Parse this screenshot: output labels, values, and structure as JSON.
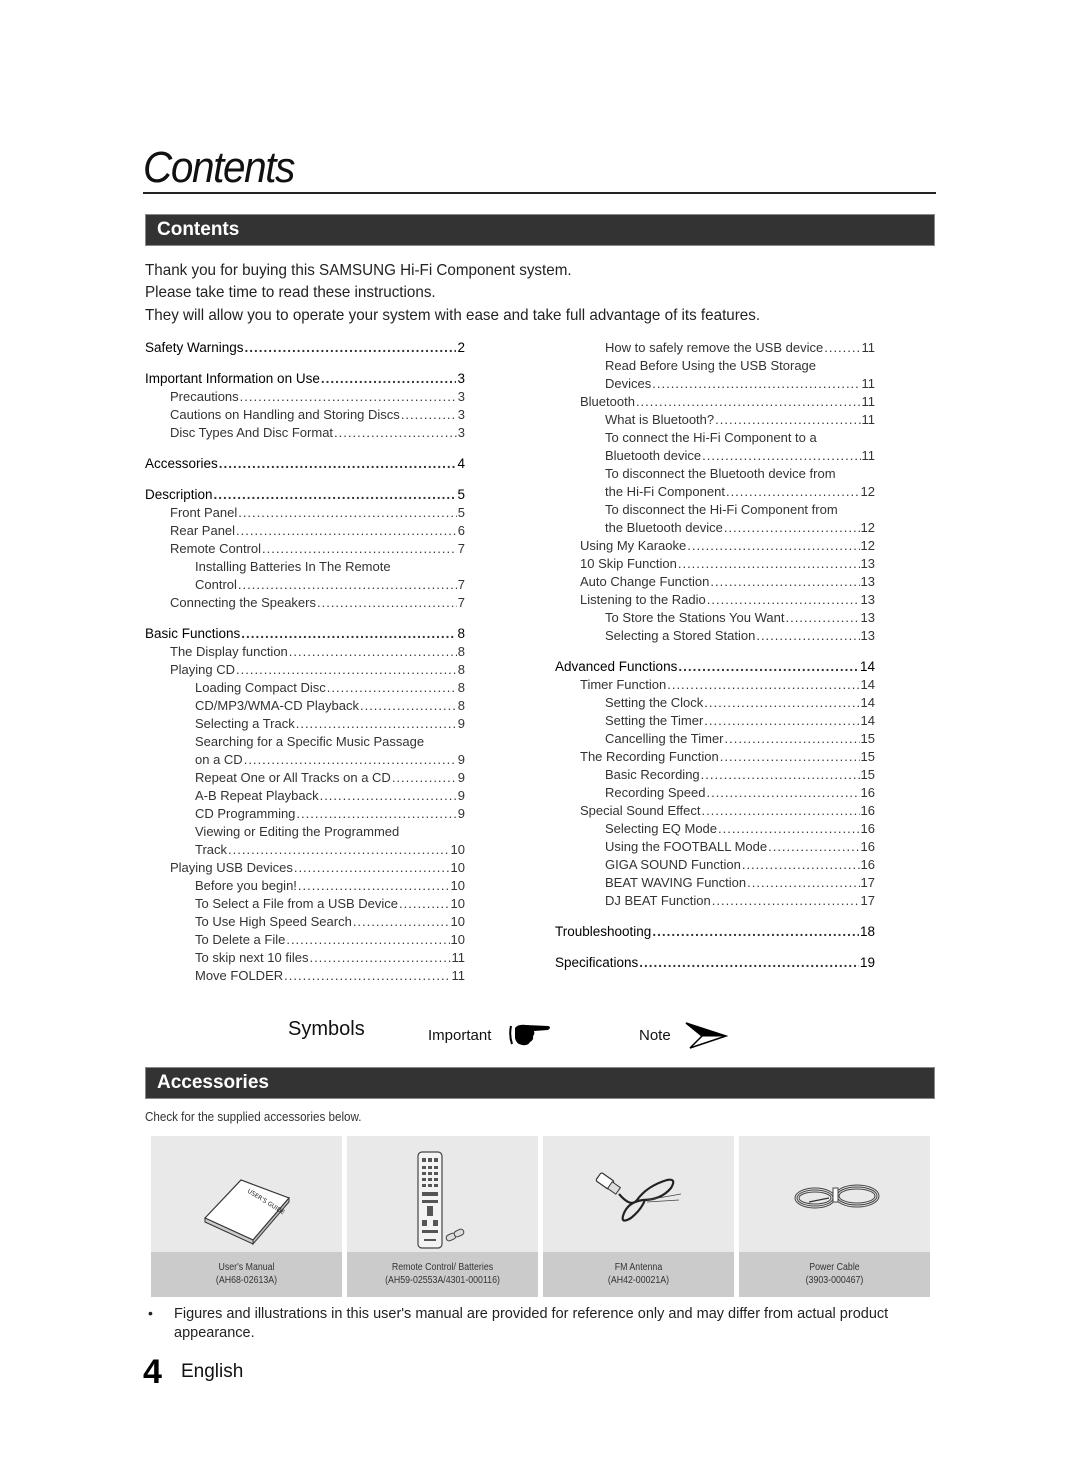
{
  "page": {
    "title": "Contents",
    "page_number": "4",
    "language": "English"
  },
  "contents_section": {
    "heading": "Contents",
    "intro_lines": [
      "Thank you for buying this SAMSUNG Hi-Fi Component system.",
      "Please take time to read these instructions.",
      "They will allow you to operate your system with ease and take full advantage of its features."
    ]
  },
  "toc": {
    "left": [
      {
        "label": "Safety Warnings",
        "page": "2",
        "level": 0
      },
      {
        "label": "Important Information on Use",
        "page": "3",
        "level": 0
      },
      {
        "label": "Precautions",
        "page": "3",
        "level": 1
      },
      {
        "label": "Cautions on Handling and Storing Discs",
        "page": "3",
        "level": 1
      },
      {
        "label": "Disc Types And Disc Format",
        "page": "3",
        "level": 1
      },
      {
        "label": "Accessories",
        "page": "4",
        "level": 0
      },
      {
        "label": "Description",
        "page": "5",
        "level": 0
      },
      {
        "label": "Front Panel",
        "page": "5",
        "level": 1
      },
      {
        "label": "Rear Panel",
        "page": "6",
        "level": 1
      },
      {
        "label": "Remote Control",
        "page": "7",
        "level": 1
      },
      {
        "label": "Installing Batteries In The Remote",
        "page": "",
        "level": 2
      },
      {
        "label": "Control",
        "page": "7",
        "level": 2
      },
      {
        "label": "Connecting the Speakers",
        "page": "7",
        "level": 1
      },
      {
        "label": "Basic Functions",
        "page": "8",
        "level": 0
      },
      {
        "label": "The Display function",
        "page": "8",
        "level": 1
      },
      {
        "label": "Playing CD",
        "page": "8",
        "level": 1
      },
      {
        "label": "Loading Compact Disc",
        "page": "8",
        "level": 2
      },
      {
        "label": "CD/MP3/WMA-CD Playback",
        "page": "8",
        "level": 2
      },
      {
        "label": "Selecting a Track",
        "page": "9",
        "level": 2
      },
      {
        "label": "Searching for a Specific Music Passage",
        "page": "",
        "level": 2
      },
      {
        "label": "on a CD",
        "page": "9",
        "level": 2
      },
      {
        "label": "Repeat One or All Tracks on a CD",
        "page": "9",
        "level": 2
      },
      {
        "label": "A-B Repeat Playback",
        "page": "9",
        "level": 2
      },
      {
        "label": "CD Programming",
        "page": "9",
        "level": 2
      },
      {
        "label": "Viewing or Editing the Programmed",
        "page": "",
        "level": 2
      },
      {
        "label": "Track",
        "page": "10",
        "level": 2
      },
      {
        "label": "Playing USB Devices",
        "page": "10",
        "level": 1
      },
      {
        "label": "Before you begin!",
        "page": "10",
        "level": 2
      },
      {
        "label": "To Select a File from a USB Device",
        "page": "10",
        "level": 2
      },
      {
        "label": "To Use High Speed Search",
        "page": "10",
        "level": 2
      },
      {
        "label": "To Delete a File",
        "page": "10",
        "level": 2
      },
      {
        "label": "To skip next 10 files",
        "page": "11",
        "level": 2
      },
      {
        "label": "Move FOLDER",
        "page": "11",
        "level": 2
      }
    ],
    "right": [
      {
        "label": "How to safely remove the USB device",
        "page": "11",
        "level": 2
      },
      {
        "label": "Read Before Using the USB Storage",
        "page": "",
        "level": 2
      },
      {
        "label": "Devices",
        "page": "11",
        "level": 2
      },
      {
        "label": "Bluetooth",
        "page": "11",
        "level": 1
      },
      {
        "label": "What is Bluetooth?",
        "page": "11",
        "level": 2
      },
      {
        "label": "To connect the Hi-Fi Component to a",
        "page": "",
        "level": 2
      },
      {
        "label": "Bluetooth device",
        "page": "11",
        "level": 2
      },
      {
        "label": "To disconnect the Bluetooth device from",
        "page": "",
        "level": 2
      },
      {
        "label": "the Hi-Fi Component",
        "page": "12",
        "level": 2
      },
      {
        "label": "To disconnect the Hi-Fi Component from",
        "page": "",
        "level": 2
      },
      {
        "label": "the Bluetooth device",
        "page": "12",
        "level": 2
      },
      {
        "label": "Using My Karaoke",
        "page": "12",
        "level": 1
      },
      {
        "label": "10 Skip Function",
        "page": "13",
        "level": 1
      },
      {
        "label": "Auto Change Function",
        "page": "13",
        "level": 1
      },
      {
        "label": "Listening to the Radio",
        "page": "13",
        "level": 1
      },
      {
        "label": "To Store the Stations You Want",
        "page": "13",
        "level": 2
      },
      {
        "label": "Selecting a Stored Station",
        "page": "13",
        "level": 2
      },
      {
        "label": "Advanced Functions",
        "page": "14",
        "level": 0
      },
      {
        "label": "Timer Function",
        "page": "14",
        "level": 1
      },
      {
        "label": "Setting the Clock",
        "page": "14",
        "level": 2
      },
      {
        "label": "Setting the Timer",
        "page": "14",
        "level": 2
      },
      {
        "label": "Cancelling the Timer",
        "page": "15",
        "level": 2
      },
      {
        "label": "The Recording Function",
        "page": "15",
        "level": 1
      },
      {
        "label": "Basic Recording",
        "page": "15",
        "level": 2
      },
      {
        "label": "Recording Speed",
        "page": "16",
        "level": 2
      },
      {
        "label": "Special Sound Effect",
        "page": "16",
        "level": 1
      },
      {
        "label": "Selecting EQ Mode",
        "page": "16",
        "level": 2
      },
      {
        "label": "Using the FOOTBALL Mode",
        "page": "16",
        "level": 2
      },
      {
        "label": "GIGA SOUND Function",
        "page": "16",
        "level": 2
      },
      {
        "label": "BEAT WAVING Function",
        "page": "17",
        "level": 2
      },
      {
        "label": "DJ BEAT Function",
        "page": "17",
        "level": 2
      },
      {
        "label": "Troubleshooting",
        "page": "18",
        "level": 0
      },
      {
        "label": "Specifications",
        "page": "19",
        "level": 0
      }
    ]
  },
  "symbols": {
    "label": "Symbols",
    "important_label": "Important",
    "important_icon": "pointing-hand-icon",
    "note_label": "Note",
    "note_icon": "paper-plane-arrow-icon"
  },
  "accessories_section": {
    "heading": "Accessories",
    "intro": "Check for the supplied accessories below.",
    "items": [
      {
        "name": "User's Manual",
        "part": "(AH68-02613A)",
        "icon": "manual-book-icon"
      },
      {
        "name": "Remote Control/ Batteries",
        "part": "(AH59-02553A/4301-000116)",
        "icon": "remote-control-icon"
      },
      {
        "name": "FM Antenna",
        "part": "(AH42-00021A)",
        "icon": "fm-antenna-icon"
      },
      {
        "name": "Power Cable",
        "part": "(3903-000467)",
        "icon": "power-cable-icon"
      }
    ],
    "note": "Figures and illustrations in this user's manual are provided for reference only and may differ from actual product appearance.",
    "bullet": "•"
  }
}
